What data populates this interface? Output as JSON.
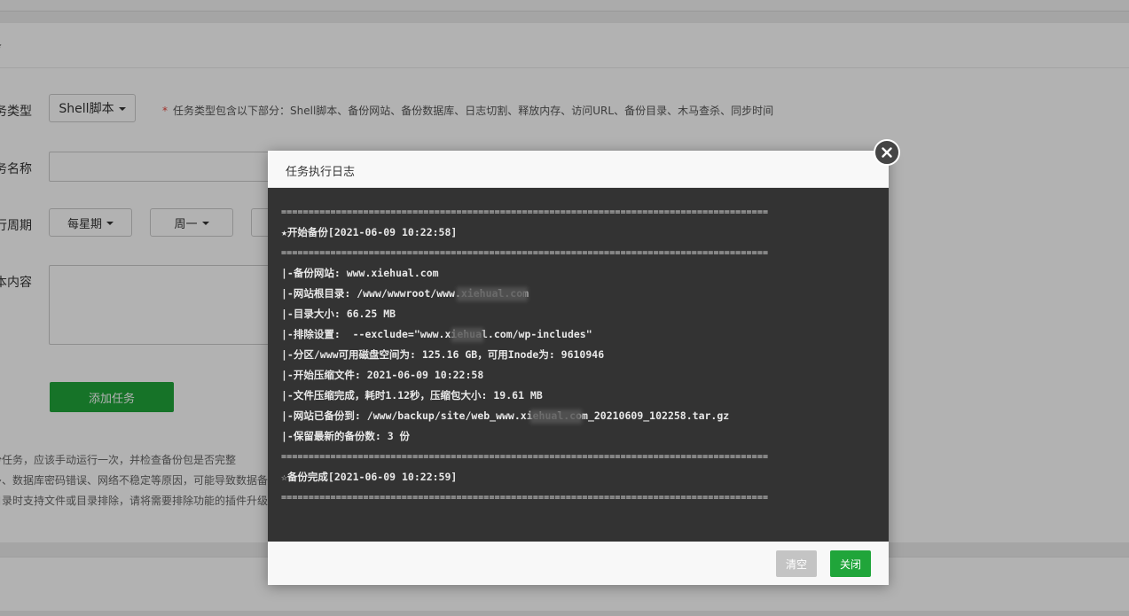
{
  "page": {
    "panel_title": "务",
    "form": {
      "task_type_label": "务类型",
      "task_type_value": "Shell脚本",
      "task_type_note": "任务类型包含以下部分：Shell脚本、备份网站、备份数据库、日志切割、释放内存、访问URL、备份目录、木马查杀、同步时间",
      "task_name_label": "务名称",
      "task_name_value": "",
      "period_label": "行周期",
      "period_value": "每星期",
      "weekday_value": "周一",
      "script_label": "本内容",
      "script_value": "",
      "add_button": "添加任务"
    },
    "tips": [
      "份任务，应该手动运行一次，并检查备份包是否完整",
      "多、数据库密码错误、网络不稳定等原因，可能导致数据备",
      "目录时支持文件或目录排除，请将需要排除功能的插件升级"
    ]
  },
  "modal": {
    "title": "任务执行日志",
    "log": {
      "separator": "=========================================================================================",
      "start": "★开始备份[2021-06-09 10:22:58]",
      "lines": [
        "|-备份网站: www.xiehual.com",
        "|-网站根目录: /www/wwwroot/www.xiehual.com",
        "|-目录大小: 66.25 MB",
        "|-排除设置:  --exclude=\"www.xiehual.com/wp-includes\"",
        "|-分区/www可用磁盘空间为: 125.16 GB，可用Inode为: 9610946",
        "|-开始压缩文件: 2021-06-09 10:22:58",
        "|-文件压缩完成，耗时1.12秒，压缩包大小: 19.61 MB",
        "|-网站已备份到: /www/backup/site/web_www.xiehual.com_20210609_102258.tar.gz",
        "|-保留最新的备份数: 3 份"
      ],
      "end": "☆备份完成[2021-06-09 10:22:59]"
    },
    "clear_button": "清空",
    "close_button": "关闭",
    "close_icon": "close-icon"
  },
  "colors": {
    "accent_green": "#20a53a",
    "log_background": "#333333",
    "required_star": "#e8453c"
  }
}
